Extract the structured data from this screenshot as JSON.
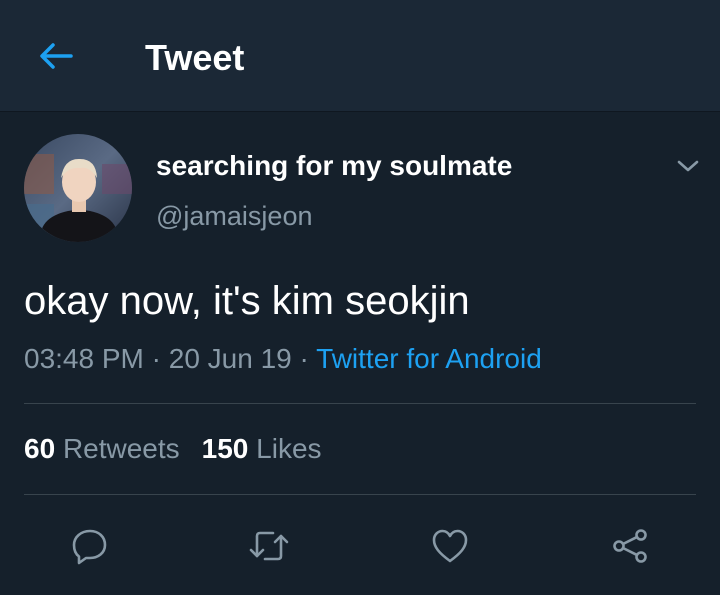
{
  "header": {
    "title": "Tweet",
    "back_icon": "arrow-left-icon"
  },
  "tweet": {
    "author": {
      "display_name": "searching for my soulmate",
      "handle": "@jamaisjeon"
    },
    "text": "okay now, it's kim seokjin",
    "time": "03:48 PM",
    "date": "20 Jun 19",
    "source": "Twitter for Android",
    "separator": " · ",
    "stats": {
      "retweets_count": "60",
      "retweets_label": "Retweets",
      "likes_count": "150",
      "likes_label": "Likes"
    }
  },
  "actions": [
    "reply-icon",
    "retweet-icon",
    "like-icon",
    "share-icon"
  ],
  "colors": {
    "background": "#15202b",
    "header_background": "#1b2836",
    "accent": "#1da1f2",
    "secondary_text": "#8899a6",
    "divider": "#38444d"
  }
}
